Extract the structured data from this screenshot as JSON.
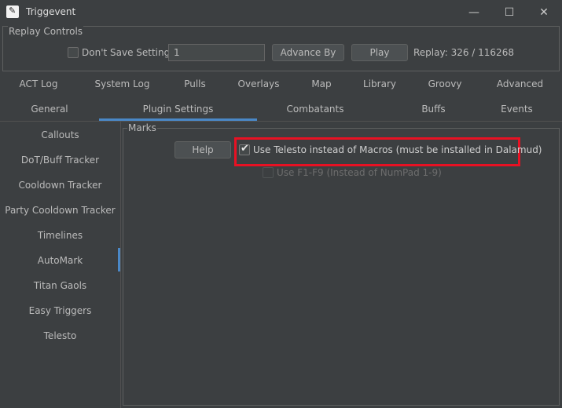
{
  "window": {
    "title": "Triggevent",
    "controls": {
      "minimize": "—",
      "maximize": "☐",
      "close": "✕"
    }
  },
  "replay_controls": {
    "legend": "Replay Controls",
    "dont_save_label": "Don't Save Settings",
    "advance_value": "1",
    "advance_button": "Advance By",
    "play_button": "Play",
    "status": "Replay: 326 / 116268"
  },
  "tabs_row1": [
    "ACT Log",
    "System Log",
    "Pulls",
    "Overlays",
    "Map",
    "Library",
    "Groovy",
    "Advanced"
  ],
  "tabs_row2": [
    "General",
    "Plugin Settings",
    "Combatants",
    "Buffs",
    "Events"
  ],
  "selected_tab": "Plugin Settings",
  "sidebar": {
    "items": [
      "Callouts",
      "DoT/Buff Tracker",
      "Cooldown Tracker",
      "Party Cooldown Tracker",
      "Timelines",
      "AutoMark",
      "Titan Gaols",
      "Easy Triggers",
      "Telesto"
    ],
    "selected": "AutoMark"
  },
  "marks": {
    "legend": "Marks",
    "help_button": "Help",
    "telesto_label": "Use Telesto instead of Macros (must be installed in Dalamud)",
    "telesto_checked": true,
    "f1f9_label": "Use F1-F9 (Instead of NumPad 1-9)",
    "f1f9_checked": false,
    "f1f9_enabled": false
  },
  "colors": {
    "background": "#3c3f41",
    "accent": "#4a88c7",
    "highlight": "#e81123"
  }
}
